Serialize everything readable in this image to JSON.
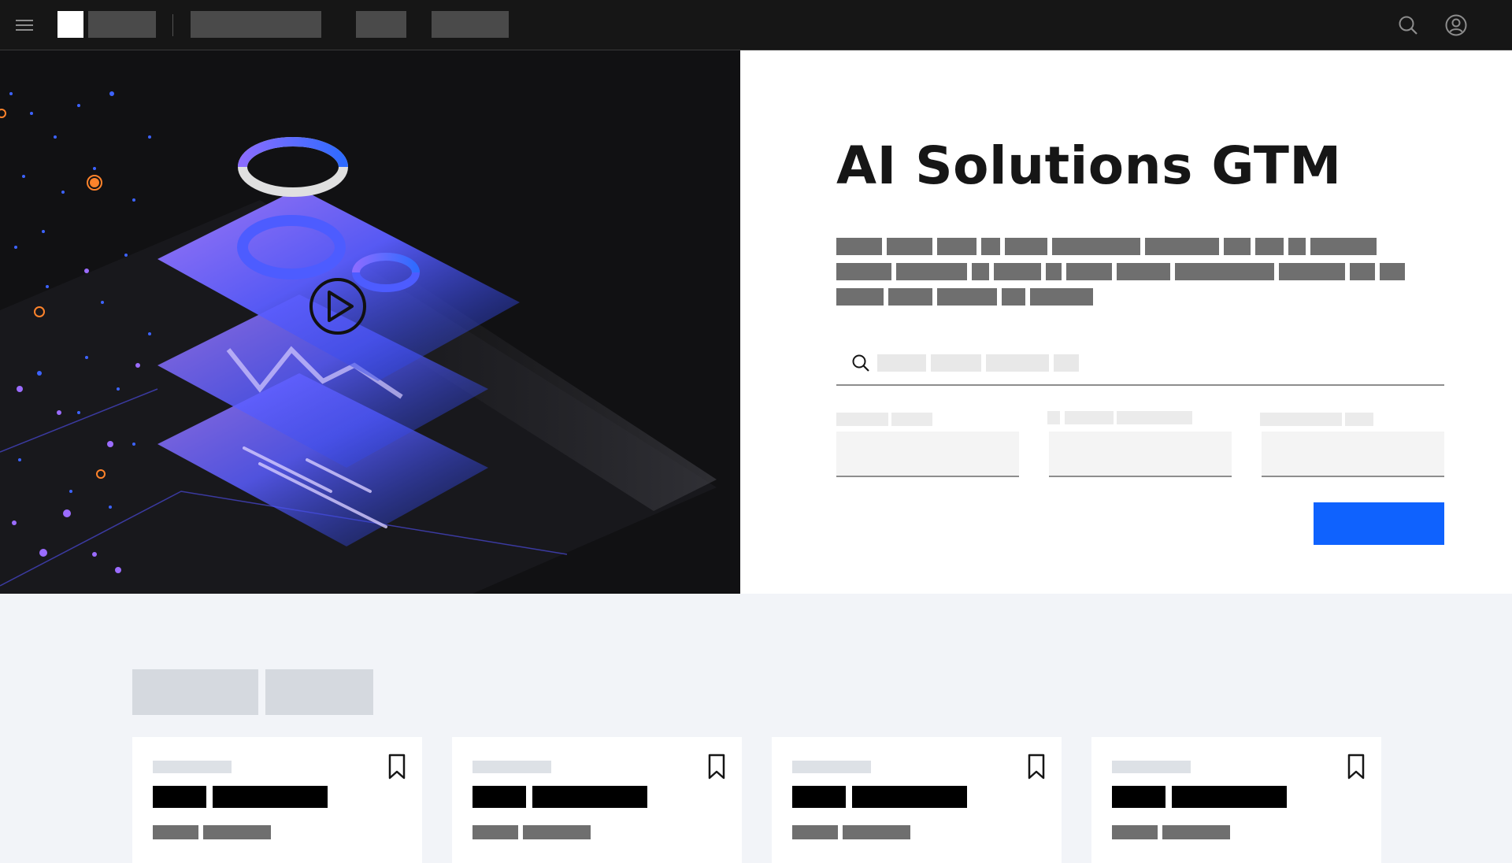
{
  "hero": {
    "title": "AI Solutions GTM",
    "media": {
      "play_icon": "play-circle-icon"
    }
  },
  "nav": {
    "icons": {
      "menu": "menu-icon",
      "search": "search-icon",
      "user": "user-avatar-icon"
    }
  },
  "search": {
    "icon": "search-icon"
  },
  "cards": [
    {
      "bookmark_icon": "bookmark-icon"
    },
    {
      "bookmark_icon": "bookmark-icon"
    },
    {
      "bookmark_icon": "bookmark-icon"
    },
    {
      "bookmark_icon": "bookmark-icon"
    }
  ],
  "colors": {
    "nav_bg": "#161616",
    "media_bg": "#111113",
    "primary": "#0f62fe",
    "page_bg": "#f2f4f8",
    "accent_purple": "#8a6cff",
    "accent_orange": "#ff832b"
  }
}
